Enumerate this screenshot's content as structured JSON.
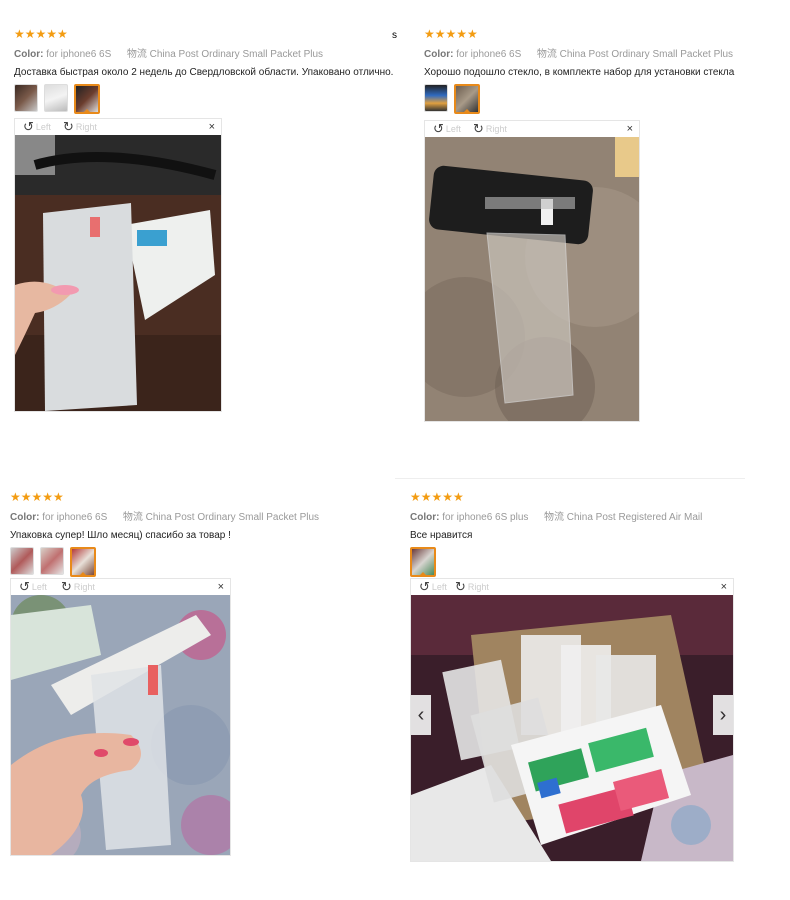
{
  "stray_char": "s",
  "common": {
    "stars": "★★★★★",
    "color_label": "Color:",
    "shipping_prefix": "物流",
    "rotate_left": "Left",
    "rotate_right": "Right",
    "close_glyph": "×",
    "prev_glyph": "‹",
    "next_glyph": "›",
    "rotate_left_icon": "↺",
    "rotate_right_icon": "↻"
  },
  "reviews": [
    {
      "color_value": "for iphone6 6S",
      "shipping": "China Post Ordinary Small Packet Plus",
      "text": "Доставка быстрая около 2 недель до Свердловской области. Упаковано отлично."
    },
    {
      "color_value": "for iphone6 6S",
      "shipping": "China Post Ordinary Small Packet Plus",
      "text": "Хорошо подошло стекло, в комплекте набор для установки стекла"
    },
    {
      "color_value": "for iphone6 6S",
      "shipping": "China Post Ordinary Small Packet Plus",
      "text": "Упаковка супер! Шло месяц) спасибо за товар !"
    },
    {
      "color_value": "for iphone6 6S plus",
      "shipping": "China Post Registered Air Mail",
      "text": "Все нравится"
    }
  ],
  "colors": {
    "star": "#f39c12",
    "active_thumb_border": "#e88a1a"
  }
}
